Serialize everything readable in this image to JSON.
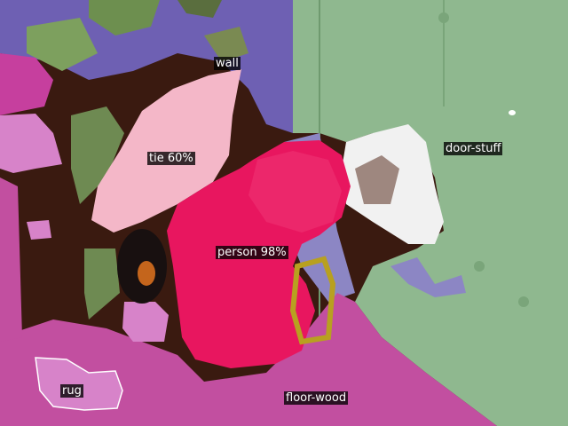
{
  "segments": [
    {
      "key": "wall",
      "label": "wall",
      "color": "#7f6ec9"
    },
    {
      "key": "tie",
      "label": "tie 60%",
      "color": "#f4b7c8"
    },
    {
      "key": "door_stuff",
      "label": "door-stuff",
      "color": "#8fb88f"
    },
    {
      "key": "person",
      "label": "person 98%",
      "color": "#e8165f"
    },
    {
      "key": "rug",
      "label": "rug",
      "color": "#d783c9"
    },
    {
      "key": "floor_wood",
      "label": "floor-wood",
      "color": "#c24fa0"
    }
  ]
}
